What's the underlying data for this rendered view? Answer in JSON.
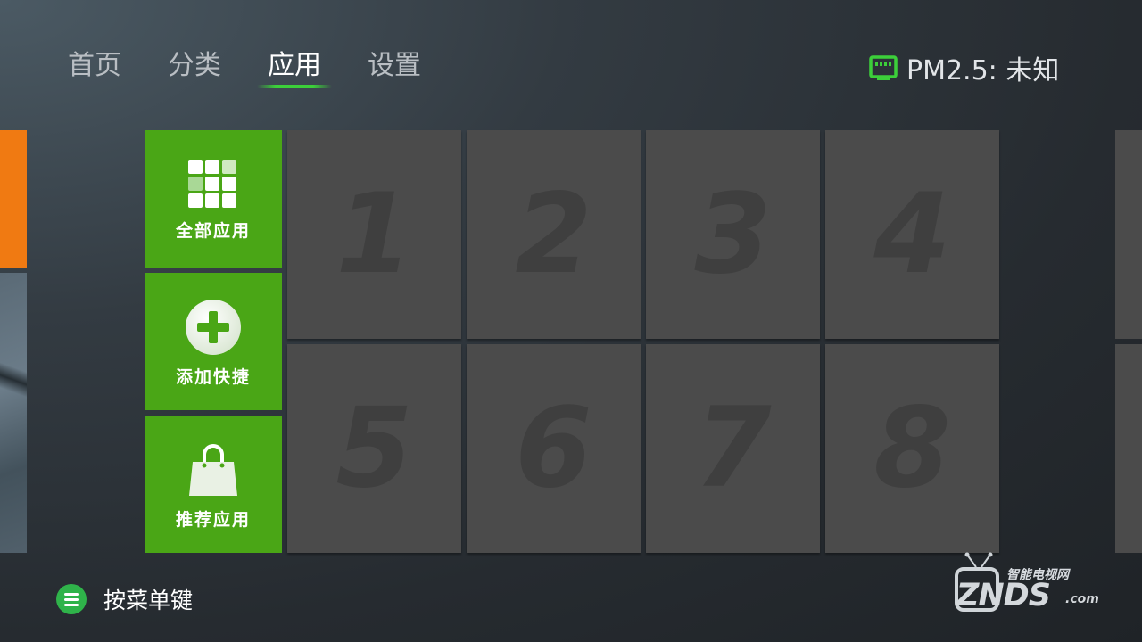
{
  "nav": {
    "tabs": [
      {
        "label": "首页"
      },
      {
        "label": "分类"
      },
      {
        "label": "应用"
      },
      {
        "label": "设置"
      }
    ],
    "active_tab": "应用"
  },
  "status": {
    "pm_label": "PM2.5: 未知",
    "icon": "ethernet-icon",
    "icon_color": "#3ccf3a"
  },
  "shortcuts": [
    {
      "label": "全部应用",
      "icon": "app-grid-icon"
    },
    {
      "label": "添加快捷",
      "icon": "add-circle-icon"
    },
    {
      "label": "推荐应用",
      "icon": "shopping-bag-icon"
    }
  ],
  "app_slots": [
    "1",
    "2",
    "3",
    "4",
    "5",
    "6",
    "7",
    "8"
  ],
  "hint": {
    "text": "按菜单键",
    "icon": "menu-icon"
  },
  "watermark": {
    "cn": "智能电视网",
    "logo": "ZNDS",
    "suffix": ".com"
  },
  "colors": {
    "accent_green": "#4aa616",
    "highlight_green": "#3ccf3a",
    "orange_tile": "#f07a12",
    "slot_gray": "#4b4b4b"
  }
}
